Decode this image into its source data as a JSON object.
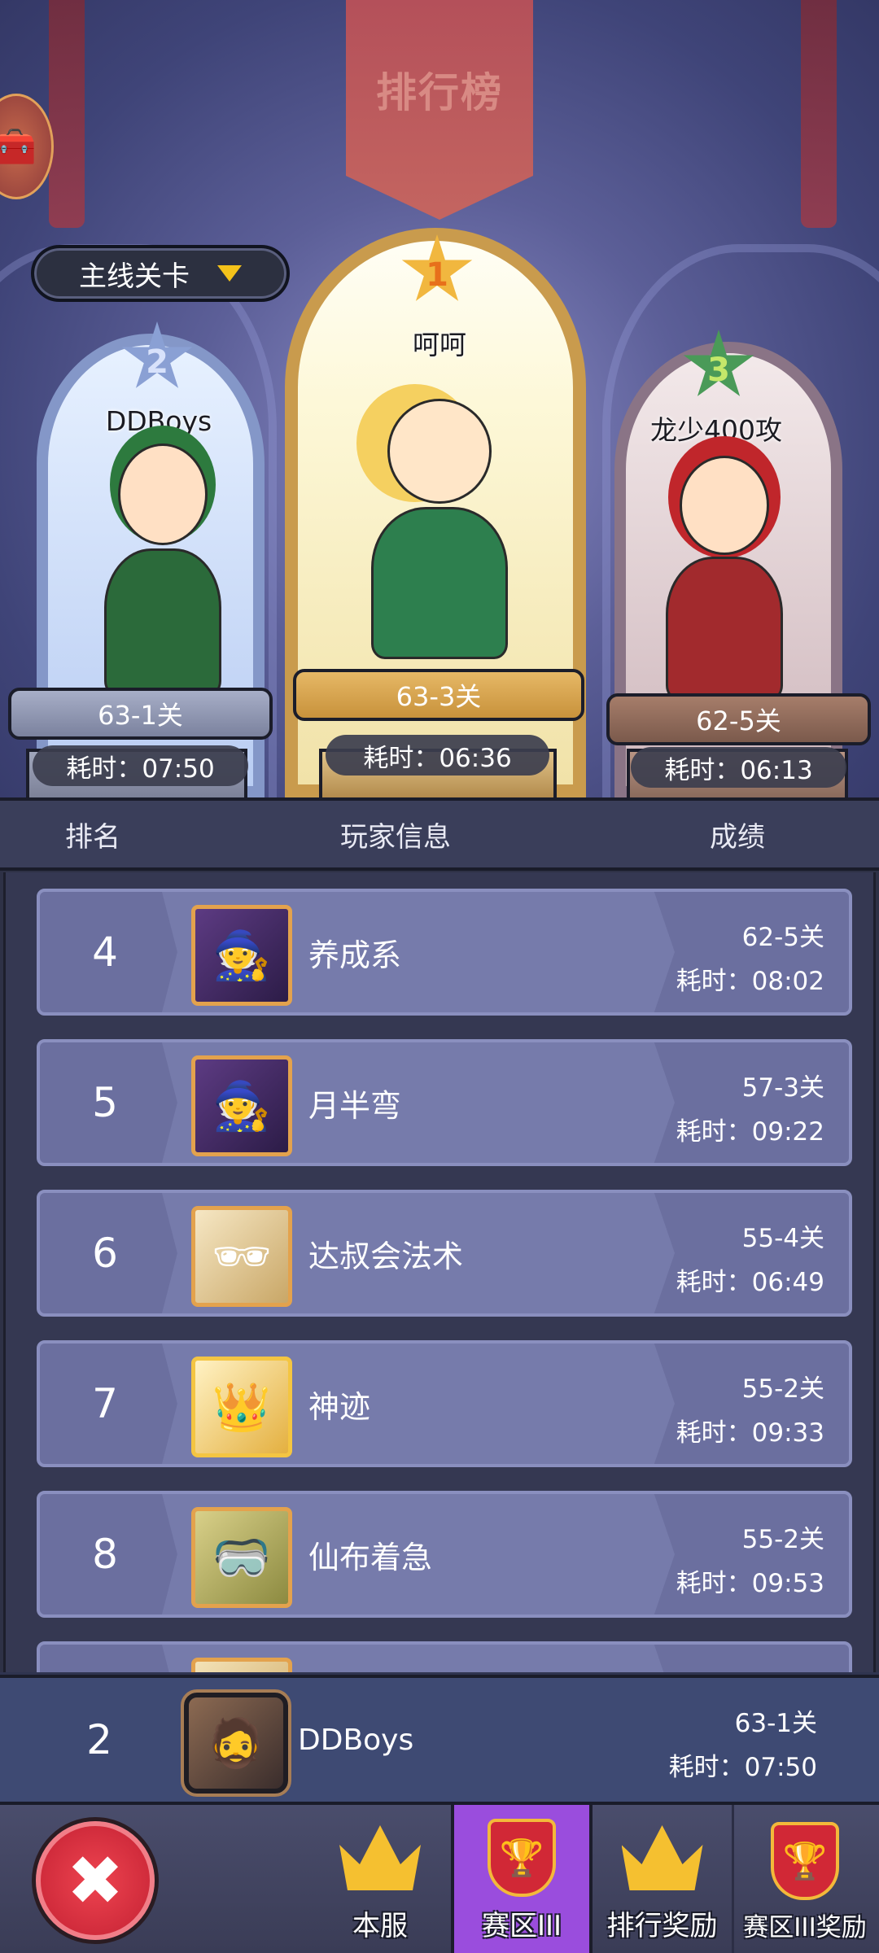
{
  "title": "排行榜",
  "mode_select": {
    "label": "主线关卡"
  },
  "podium": [
    {
      "rank": "1",
      "name": "呵呵",
      "stage": "63-3关",
      "time": "耗时：06:36"
    },
    {
      "rank": "2",
      "name": "DDBoys",
      "stage": "63-1关",
      "time": "耗时：07:50"
    },
    {
      "rank": "3",
      "name": "龙少400攻",
      "stage": "62-5关",
      "time": "耗时：06:13"
    }
  ],
  "table_header": {
    "rank": "排名",
    "player": "玩家信息",
    "score": "成绩"
  },
  "rows": [
    {
      "rank": "4",
      "name": "养成系",
      "stage": "62-5关",
      "time": "耗时：08:02"
    },
    {
      "rank": "5",
      "name": "月半弯",
      "stage": "57-3关",
      "time": "耗时：09:22"
    },
    {
      "rank": "6",
      "name": "达叔会法术",
      "stage": "55-4关",
      "time": "耗时：06:49"
    },
    {
      "rank": "7",
      "name": "神迹",
      "stage": "55-2关",
      "time": "耗时：09:33"
    },
    {
      "rank": "8",
      "name": "仙布着急",
      "stage": "55-2关",
      "time": "耗时：09:53"
    }
  ],
  "my_rank": {
    "rank": "2",
    "name": "DDBoys",
    "stage": "63-1关",
    "time": "耗时：07:50"
  },
  "nav": {
    "close": "✖",
    "tabs": [
      {
        "label": "本服",
        "icon": "crown-icon"
      },
      {
        "label": "赛区III",
        "icon": "trophy-shield-icon",
        "selected": true
      },
      {
        "label": "排行奖励",
        "icon": "crown-reward-icon"
      },
      {
        "label": "赛区III奖励",
        "icon": "trophy-chest-icon"
      }
    ]
  },
  "colors": {
    "accent_tab": "#9a4ddd",
    "row_bg": "#6b6f9f",
    "close_red": "#d42e3c"
  }
}
